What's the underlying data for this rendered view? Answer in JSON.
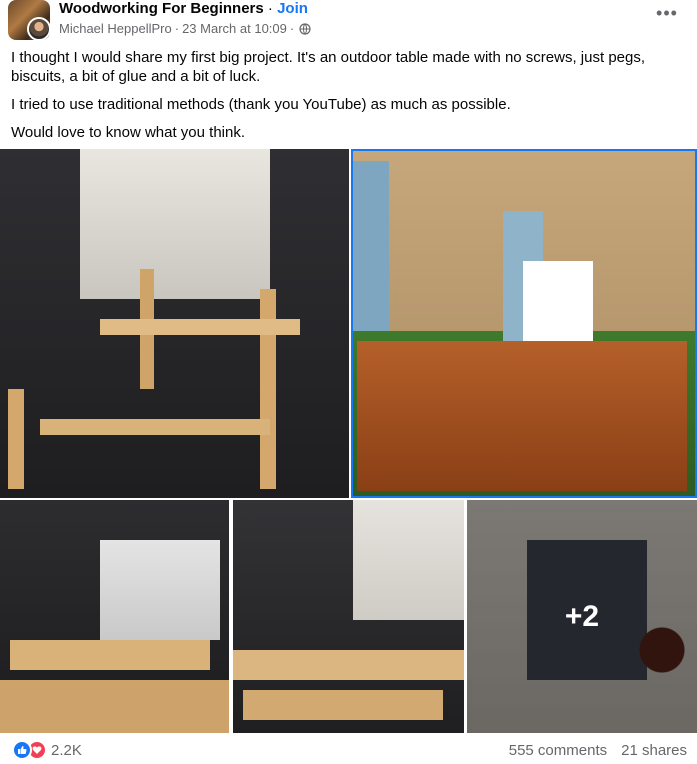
{
  "header": {
    "group_name": "Woodworking For Beginners",
    "separator": "·",
    "join_label": "Join",
    "author": "Michael HeppellPro",
    "timestamp": "23 March at 10:09",
    "meta_separator": "·",
    "privacy_icon": "globe-icon",
    "more_icon": "more-options-icon"
  },
  "post": {
    "paragraphs": [
      "I thought I would share my first big project. It's an outdoor table made with no screws, just pegs, biscuits, a bit of glue and a bit of luck.",
      "I tried to use traditional methods (thank you YouTube) as much as possible.",
      "Would love to know what you think."
    ]
  },
  "photos": {
    "extra_count": "+2"
  },
  "footer": {
    "reaction_icons": [
      "like-icon",
      "love-icon"
    ],
    "reaction_count": "2.2K",
    "comments": "555 comments",
    "shares": "21 shares"
  },
  "colors": {
    "accent": "#1877f2",
    "secondary_text": "#65676b",
    "love": "#f33e58"
  }
}
